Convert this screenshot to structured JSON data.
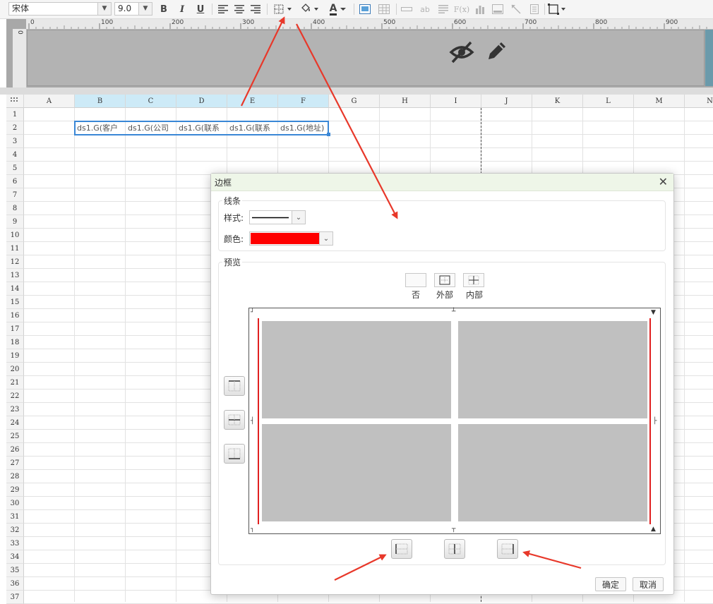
{
  "toolbar": {
    "font_name": "宋体",
    "font_size": "9.0",
    "bold": "B",
    "italic": "I",
    "underline": "U",
    "font_color_letter": "A",
    "text_ab": "ab",
    "formula": "F(x)"
  },
  "ruler": {
    "ticks": [
      "0",
      "100",
      "200",
      "300",
      "400",
      "500",
      "600",
      "700",
      "800",
      "900"
    ],
    "v_tick": "0"
  },
  "sheet": {
    "columns": [
      "A",
      "B",
      "C",
      "D",
      "E",
      "F",
      "G",
      "H",
      "I",
      "J",
      "K",
      "L",
      "M",
      "N"
    ],
    "selected_columns": [
      "B",
      "C",
      "D",
      "E",
      "F"
    ],
    "rows": [
      "1",
      "2",
      "3",
      "4",
      "5",
      "6",
      "7",
      "8",
      "9",
      "10",
      "11",
      "12",
      "13",
      "14",
      "15",
      "16",
      "17",
      "18",
      "19",
      "20",
      "21",
      "22",
      "23",
      "24",
      "25",
      "26",
      "27",
      "28",
      "29",
      "30",
      "31",
      "32",
      "33",
      "34",
      "35",
      "36",
      "37"
    ],
    "row2_cells": [
      "ds1.G(客户",
      "ds1.G(公司",
      "ds1.G(联系",
      "ds1.G(联系",
      "ds1.G(地址)"
    ]
  },
  "dialog": {
    "title": "边框",
    "line_section": "线条",
    "style_label": "样式:",
    "color_label": "颜色:",
    "color_value": "#ff0000",
    "preview_section": "预览",
    "preset_none": "否",
    "preset_outer": "外部",
    "preset_inner": "内部",
    "ok": "确定",
    "cancel": "取消"
  },
  "colors": {
    "accent_red": "#e02020",
    "selection_blue": "#3a87d6",
    "selected_header": "#cdeaf7",
    "dialog_header": "#eef6e8"
  }
}
